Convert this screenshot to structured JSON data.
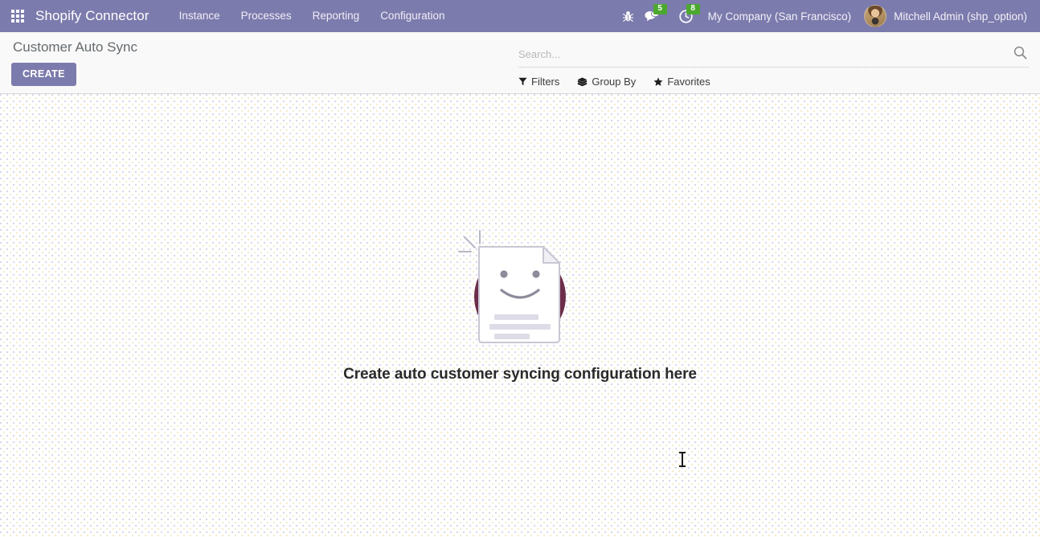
{
  "navbar": {
    "apps_icon": "apps-grid-icon",
    "brand": "Shopify Connector",
    "menu_items": [
      {
        "label": "Instance"
      },
      {
        "label": "Processes"
      },
      {
        "label": "Reporting"
      },
      {
        "label": "Configuration"
      }
    ],
    "debug_icon": "bug-icon",
    "messages_icon": "chat-bubble-icon",
    "messages_count": "5",
    "activities_icon": "clock-icon",
    "activities_count": "8",
    "company": "My Company (San Francisco)",
    "avatar_icon": "user-avatar",
    "user": "Mitchell Admin (shp_option)",
    "bg_color": "#7C7BAD",
    "badge_color": "#4ba82e"
  },
  "control_panel": {
    "title": "Customer Auto Sync",
    "create_label": "CREATE",
    "create_color": "#7C7BAD",
    "search": {
      "placeholder": "Search...",
      "value": "",
      "icon": "magnifier-icon"
    },
    "filters": [
      {
        "label": "Filters",
        "icon": "funnel-icon"
      },
      {
        "label": "Group By",
        "icon": "layers-icon"
      },
      {
        "label": "Favorites",
        "icon": "star-icon"
      }
    ]
  },
  "content": {
    "illustration": "smiling-document-illustration",
    "message": "Create auto customer syncing configuration here",
    "illustration_circle_color": "#6b2d4a",
    "illustration_doc_color": "#ffffff"
  }
}
